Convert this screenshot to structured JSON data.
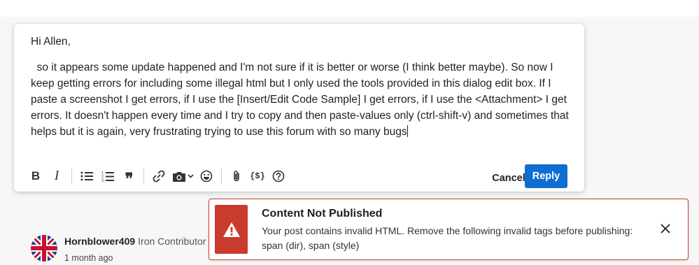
{
  "editor": {
    "greeting": "Hi Allen,",
    "message": "  so it appears some update happened and I'm not sure if it is better or worse (I think better maybe). So now I keep getting errors for including some illegal html but I only used the tools provided in this dialog edit box. If I paste a screenshot I get errors, if I use the [Insert/Edit Code Sample] I get errors, if I use the <Attachment> I get errors. It doesn't happen every time and I try to copy and then paste-values only (ctrl-shift-v) and sometimes that helps but it is again, very frustrating trying to use this forum with so many bugs",
    "toolbar": {
      "bold_glyph": "B",
      "italic_glyph": "I",
      "quote_glyph": "❞",
      "code_glyph": "{$}",
      "icons": [
        "bold-icon",
        "italic-icon",
        "bullet-list-icon",
        "numbered-list-icon",
        "quote-icon",
        "link-icon",
        "camera-icon",
        "chevron-down-icon",
        "emoji-icon",
        "attachment-icon",
        "code-sample-icon",
        "help-icon"
      ]
    },
    "cancel_label": "Cancel",
    "reply_label": "Reply",
    "accent_color": "#0f6ed2"
  },
  "author": {
    "name": "Hornblower409",
    "rank": "Iron Contributor",
    "time": "1 month ago"
  },
  "toast": {
    "title": "Content Not Published",
    "message": "Your post contains invalid HTML. Remove the following invalid tags before publishing: span (dir), span (style)",
    "icon": "warning-icon",
    "close_icon": "close-icon",
    "error_color": "#c93b2c"
  }
}
